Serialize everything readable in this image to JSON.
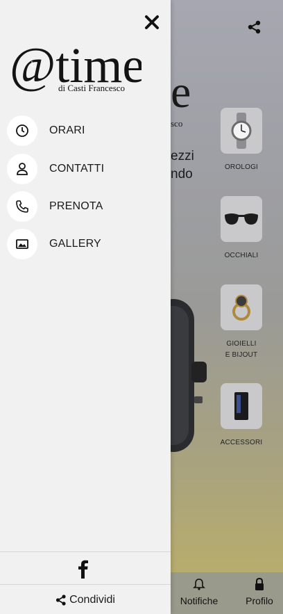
{
  "background_app": {
    "logo_fragment_main": "e",
    "logo_fragment_sub": "sco",
    "hero_line_1": "ezzi",
    "hero_line_2": "ndo",
    "categories": [
      {
        "label": "OROLOGI",
        "icon": "watch-icon"
      },
      {
        "label": "OCCHIALI",
        "icon": "sunglasses-icon"
      },
      {
        "label": "GIOIELLI\nE BIJOUT",
        "icon": "ring-icon"
      },
      {
        "label": "ACCESSORI",
        "icon": "lighter-icon"
      }
    ],
    "tabs": [
      {
        "label": "Notifiche",
        "icon": "bell-icon"
      },
      {
        "label": "Profilo",
        "icon": "lock-icon"
      }
    ]
  },
  "drawer": {
    "logo": {
      "brand": "@time",
      "tagline": "di Casti Francesco"
    },
    "menu": [
      {
        "label": "ORARI",
        "icon": "clock-icon"
      },
      {
        "label": "CONTATTI",
        "icon": "person-icon"
      },
      {
        "label": "PRENOTA",
        "icon": "phone-icon"
      },
      {
        "label": "GALLERY",
        "icon": "image-icon"
      }
    ],
    "facebook_icon": "facebook-icon",
    "share_label": "Condividi",
    "share_icon": "share-icon"
  },
  "colors": {
    "drawer_bg": "#f1f1f1",
    "icon_circle": "#ffffff",
    "text": "#1a1a1a"
  }
}
